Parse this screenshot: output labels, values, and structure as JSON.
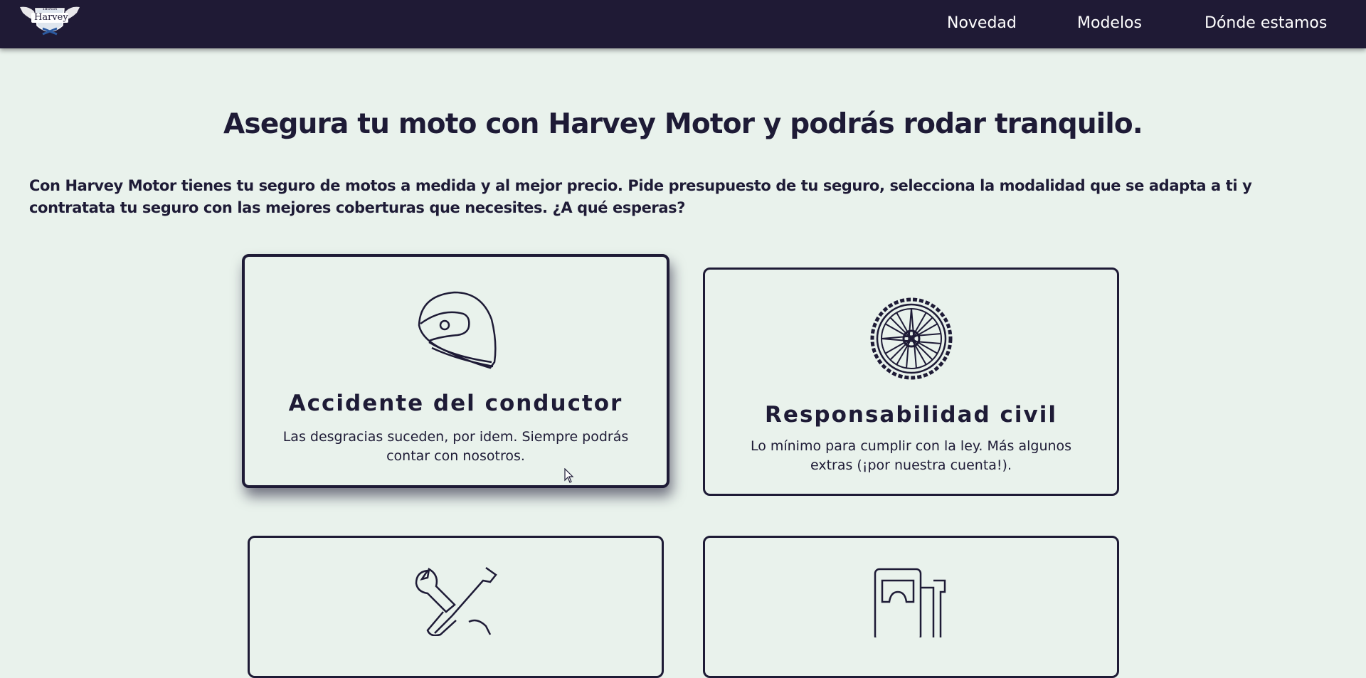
{
  "nav": {
    "logo_text_top": "motor",
    "logo_text_main": "Harvey",
    "items": [
      {
        "label": "Novedad"
      },
      {
        "label": "Modelos"
      },
      {
        "label": "Dónde estamos"
      }
    ]
  },
  "main": {
    "headline": "Asegura tu moto con Harvey Motor y podrás rodar tranquilo.",
    "intro_line1": "Con Harvey Motor tienes tu seguro de motos a medida y al mejor precio. Pide presupuesto de tu seguro, selecciona la modalidad que se adapta a ti y",
    "intro_line2": "contratata tu seguro con las mejores coberturas que necesites. ¿A qué esperas?"
  },
  "cards": [
    {
      "icon": "helmet-icon",
      "title": "Accidente del conductor",
      "desc_line1": "Las desgracias suceden, por idem. Siempre podrás",
      "desc_line2": "contar con nosotros."
    },
    {
      "icon": "wheel-icon",
      "title": "Responsabilidad civil",
      "desc_line1": "Lo mínimo para cumplir con la ley. Más algunos",
      "desc_line2": "extras (¡por nuestra cuenta!)."
    },
    {
      "icon": "tools-icon"
    },
    {
      "icon": "fuel-pump-icon"
    }
  ],
  "colors": {
    "navbar": "#1f1a35",
    "background": "#e9f2ec",
    "text": "#1e1b36"
  }
}
